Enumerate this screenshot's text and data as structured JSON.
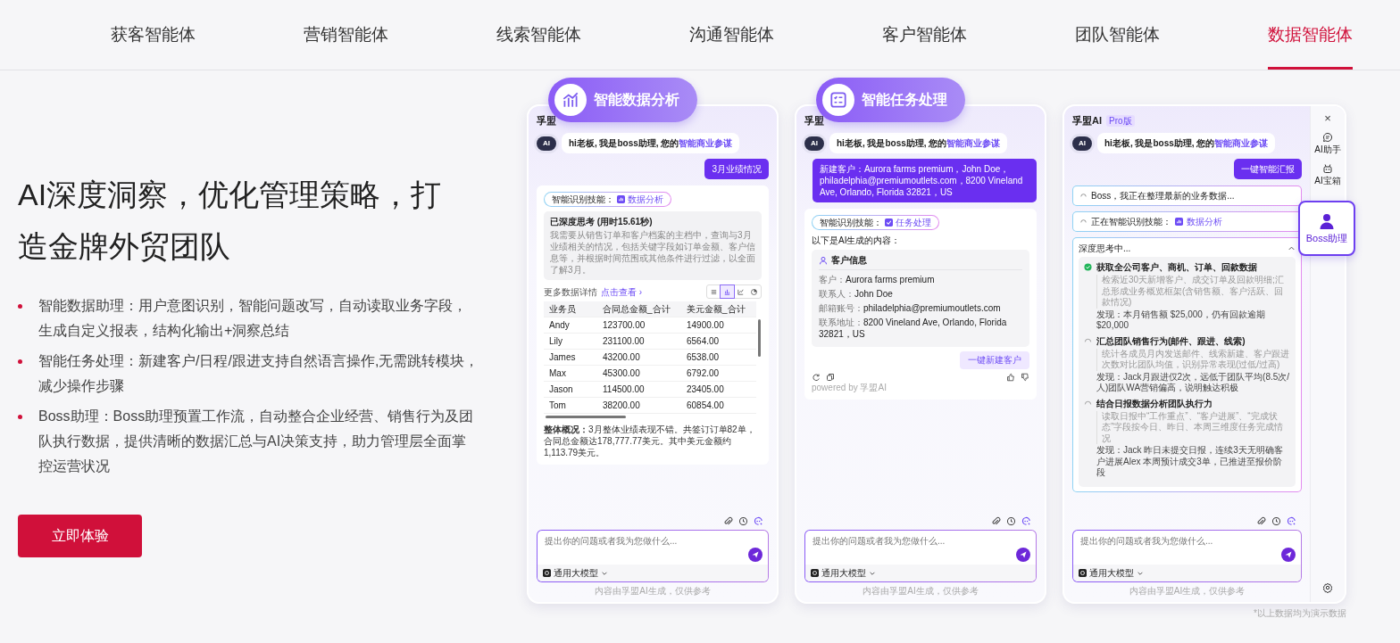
{
  "nav": {
    "tabs": [
      {
        "label": "获客智能体",
        "selected": false
      },
      {
        "label": "营销智能体",
        "selected": false
      },
      {
        "label": "线索智能体",
        "selected": false
      },
      {
        "label": "沟通智能体",
        "selected": false
      },
      {
        "label": "客户智能体",
        "selected": false
      },
      {
        "label": "团队智能体",
        "selected": false
      },
      {
        "label": "数据智能体",
        "selected": true
      }
    ]
  },
  "hero": {
    "title": "AI深度洞察，优化管理策略，打造金牌外贸团队",
    "bullets": [
      "智能数据助理：用户意图识别，智能问题改写，自动读取业务字段，生成自定义报表，结构化输出+洞察总结",
      "智能任务处理：新建客户/日程/跟进支持自然语言操作,无需跳转模块，减少操作步骤",
      "Boss助理：Boss助理预置工作流，自动整合企业经营、销售行为及团队执行数据，提供清晰的数据汇总与AI决策支持，助力管理层全面掌控运营状况"
    ],
    "cta": "立即体验"
  },
  "phones": [
    {
      "kind": "analysis",
      "badge": {
        "label": "智能数据分析"
      },
      "brand": "孚盟",
      "avatar": "AI",
      "greeting": {
        "text": "hi老板, 我是boss助理, 您的",
        "highlight": "智能商业参谋"
      },
      "user_message": "3月业绩情况",
      "skill": {
        "label": "智能识别技能：",
        "value": "数据分析"
      },
      "thinking": {
        "title": "已深度思考 (用时15.61秒)",
        "text": "我需要从销售订单和客户档案的主档中，查询与3月业绩相关的情况，包括关键字段如订单金额、客户信息等，并根据时间范围或其他条件进行过滤，以全面了解3月。"
      },
      "more": {
        "label": "更多数据详情",
        "link": "点击查看 ›"
      },
      "views": [
        {
          "kind": "list",
          "selected": false
        },
        {
          "kind": "bar",
          "selected": true
        },
        {
          "kind": "line",
          "selected": false
        },
        {
          "kind": "pie",
          "selected": false
        }
      ],
      "table": {
        "columns": [
          "业务员",
          "合同总金额_合计",
          "美元金额_合计"
        ],
        "rows": [
          [
            "Andy",
            "123700.00",
            "14900.00"
          ],
          [
            "Lily",
            "231100.00",
            "6564.00"
          ],
          [
            "James",
            "43200.00",
            "6538.00"
          ],
          [
            "Max",
            "45300.00",
            "6792.00"
          ],
          [
            "Jason",
            "114500.00",
            "23405.00"
          ],
          [
            "Tom",
            "38200.00",
            "60854.00"
          ]
        ]
      },
      "summary": "**整体概况：**3月整体业绩表现不错。共签订订单82单，合同总金额达178,777.77美元。其中美元金额约1,113.79美元。",
      "input": {
        "placeholder": "提出你的问题或者我为您做什么..."
      },
      "model": "通用大模型",
      "disclaimer": "内容由孚盟AI生成，仅供参考"
    },
    {
      "kind": "task",
      "badge": {
        "label": "智能任务处理"
      },
      "brand": "孚盟",
      "avatar": "AI",
      "greeting": {
        "text": "hi老板, 我是boss助理, 您的",
        "highlight": "智能商业参谋"
      },
      "user_message": "新建客户：Aurora farms premium，John Doe，philadelphia@premiumoutlets.com，8200 Vineland Ave, Orlando, Florida 32821，US",
      "skill": {
        "label": "智能识别技能：",
        "value": "任务处理"
      },
      "intro": "以下是AI生成的内容：",
      "customer": {
        "title": "客户信息",
        "fields": [
          {
            "label": "客户：",
            "value": "Aurora farms premium"
          },
          {
            "label": "联系人：",
            "value": "John Doe"
          },
          {
            "label": "邮箱账号：",
            "value": "philadelphia@premiumoutlets.com"
          },
          {
            "label": "联系地址：",
            "value": "8200 Vineland Ave, Orlando, Florida 32821，US"
          }
        ]
      },
      "action": "一键新建客户",
      "powered": "powered by 孚盟AI",
      "input": {
        "placeholder": "提出你的问题或者我为您做什么..."
      },
      "model": "通用大模型",
      "disclaimer": "内容由孚盟AI生成，仅供参考"
    },
    {
      "kind": "boss",
      "brand": "孚盟AI",
      "plan": "Pro版",
      "avatar": "AI",
      "sidebar": {
        "close": "×",
        "items": [
          {
            "label": "AI助手"
          },
          {
            "label": "AI宝箱"
          }
        ]
      },
      "floating": {
        "label": "Boss助理"
      },
      "greeting": {
        "text": "hi老板, 我是boss助理, 您的",
        "highlight": "智能商业参谋"
      },
      "user_message": "一键智能汇报",
      "status": [
        {
          "text": "Boss，我正在整理最新的业务数据..."
        },
        {
          "text": "正在智能识别技能：",
          "value": "数据分析"
        }
      ],
      "thinking": {
        "title": "深度思考中...",
        "steps": [
          {
            "done": true,
            "title": "获取全公司客户、商机、订单、回款数据",
            "detail": "检索近30天新增客户、成交订单及回款明细;汇总形成业务概览框架(含销售额、客户活跃、回款情况)",
            "finding": "发现：本月销售额 $25,000，仍有回款逾期$20,000"
          },
          {
            "done": false,
            "title": "汇总团队销售行为(邮件、跟进、线索)",
            "detail": "统计各成员月内发送邮件、线索新建、客户跟进次数对比团队均值，识别异常表现(过低/过高)",
            "finding": "发现：Jack月跟进仅2次，远低于团队平均(8.5次/人)团队WA营销偏高，说明触达积极"
          },
          {
            "done": false,
            "title": "结合日报数据分析团队执行力",
            "detail": "读取日报中“工作重点”、“客户进展”、“完成状态”字段按今日、昨日、本周三维度任务完成情况",
            "finding": "发现：Jack 昨日未提交日报，连续3天无明确客户进展Alex 本周预计成交3单，已推进至报价阶段"
          }
        ]
      },
      "input": {
        "placeholder": "提出你的问题或者我为您做什么..."
      },
      "model": "通用大模型",
      "disclaimer": "内容由孚盟AI生成，仅供参考",
      "footnote": "*以上数据均为演示数据"
    }
  ]
}
